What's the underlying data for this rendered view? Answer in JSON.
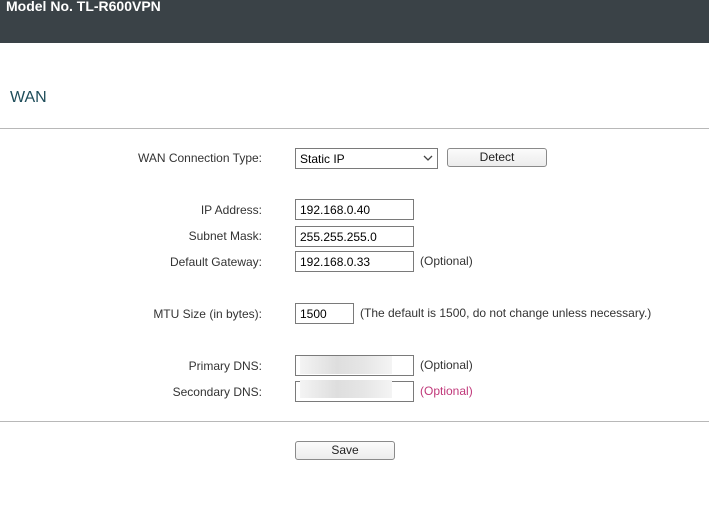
{
  "header": {
    "model": "Model No. TL-R600VPN"
  },
  "page": {
    "title": "WAN"
  },
  "wan": {
    "connection_type": {
      "label": "WAN Connection Type:",
      "value": "Static IP",
      "detect_label": "Detect"
    },
    "ip_address": {
      "label": "IP Address:",
      "value": "192.168.0.40"
    },
    "subnet_mask": {
      "label": "Subnet Mask:",
      "value": "255.255.255.0"
    },
    "default_gateway": {
      "label": "Default Gateway:",
      "value": "192.168.0.33",
      "note": "(Optional)"
    },
    "mtu": {
      "label": "MTU Size (in bytes):",
      "value": "1500",
      "note": "(The default is 1500, do not change unless necessary.)"
    },
    "primary_dns": {
      "label": "Primary DNS:",
      "value": "",
      "note": "(Optional)"
    },
    "secondary_dns": {
      "label": "Secondary DNS:",
      "value": "",
      "note": "(Optional)"
    }
  },
  "actions": {
    "save_label": "Save"
  },
  "colors": {
    "header_bg": "#3a4247",
    "title": "#1e4d5a",
    "optional_highlight": "#c0387a"
  }
}
